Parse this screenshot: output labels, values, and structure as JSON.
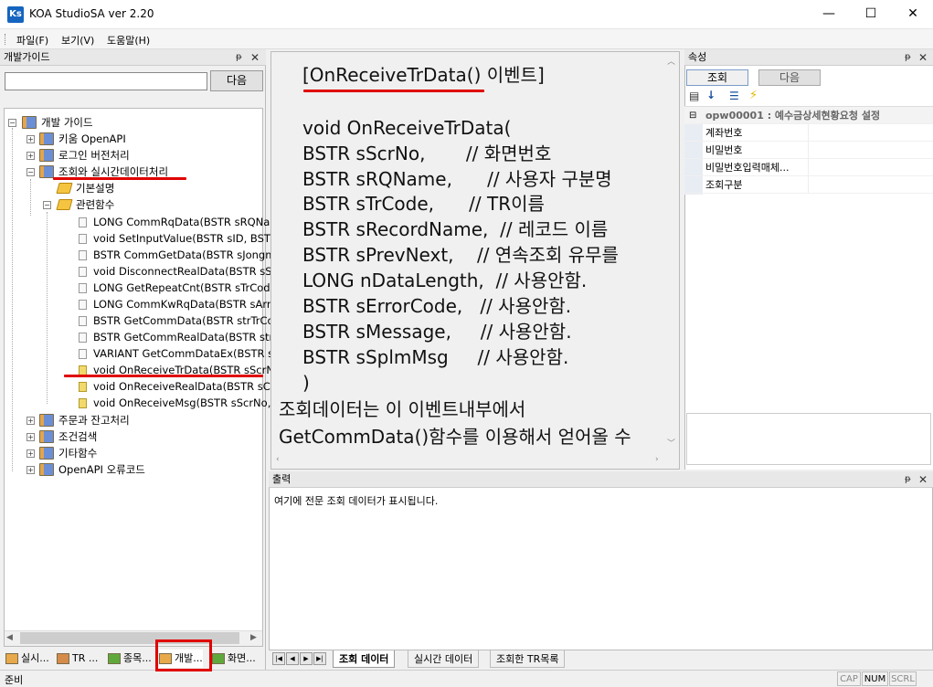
{
  "window": {
    "icon_text": "Ks",
    "title": "KOA StudioSA ver 2.20",
    "minimize": "—",
    "maximize": "☐",
    "close": "✕"
  },
  "menu": [
    {
      "label": "파일(F)"
    },
    {
      "label": "보기(V)"
    },
    {
      "label": "도움말(H)"
    }
  ],
  "left_panel": {
    "title": "개발가이드",
    "pin": "ᵽ",
    "close": "✕",
    "search_value": "",
    "next_button": "다음",
    "tree": {
      "root": "개발 가이드",
      "items": [
        {
          "label": "키움 OpenAPI"
        },
        {
          "label": "로그인 버전처리"
        },
        {
          "label": "조회와 실시간데이터처리"
        },
        {
          "label": "기본설명"
        },
        {
          "label": "관련함수"
        },
        {
          "label": "LONG CommRqData(BSTR sRQNa"
        },
        {
          "label": "void SetInputValue(BSTR sID, BSTF"
        },
        {
          "label": "BSTR CommGetData(BSTR sJongm"
        },
        {
          "label": "void DisconnectRealData(BSTR sSc"
        },
        {
          "label": "LONG GetRepeatCnt(BSTR sTrCode"
        },
        {
          "label": "LONG CommKwRqData(BSTR sArr"
        },
        {
          "label": "BSTR GetCommData(BSTR strTrCo"
        },
        {
          "label": "BSTR GetCommRealData(BSTR strC"
        },
        {
          "label": "VARIANT GetCommDataEx(BSTR s"
        },
        {
          "label": "void OnReceiveTrData(BSTR sScrN"
        },
        {
          "label": "void OnReceiveRealData(BSTR sCo"
        },
        {
          "label": "void OnReceiveMsg(BSTR sScrNo,"
        },
        {
          "label": "주문과 잔고처리"
        },
        {
          "label": "조건검색"
        },
        {
          "label": "기타함수"
        },
        {
          "label": "OpenAPI 오류코드"
        }
      ]
    },
    "bottom_tabs": [
      {
        "label": "실시..."
      },
      {
        "label": "TR ..."
      },
      {
        "label": "종목..."
      },
      {
        "label": "개발..."
      },
      {
        "label": "화면..."
      }
    ]
  },
  "doc": {
    "lines": [
      "[OnReceiveTrData() 이벤트]",
      "",
      "void OnReceiveTrData(",
      "BSTR sScrNo,       // 화면번호",
      "BSTR sRQName,      // 사용자 구분명",
      "BSTR sTrCode,      // TR이름",
      "BSTR sRecordName,  // 레코드 이름",
      "BSTR sPrevNext,    // 연속조회 유무를",
      "LONG nDataLength,  // 사용안함.",
      "BSTR sErrorCode,   // 사용안함.",
      "BSTR sMessage,     // 사용안함.",
      "BSTR sSplmMsg     // 사용안함.",
      ")",
      "조회데이터는 이 이벤트내부에서",
      "GetCommData()함수를 이용해서 얻어올 수"
    ]
  },
  "properties": {
    "title": "속성",
    "tab1": "조회",
    "tab2": "다음",
    "group": "opw00001 : 예수금상세현황요청 설정",
    "rows": [
      {
        "label": "계좌번호",
        "value": ""
      },
      {
        "label": "비밀번호",
        "value": ""
      },
      {
        "label": "비밀번호입력매체...",
        "value": ""
      },
      {
        "label": "조회구분",
        "value": ""
      }
    ]
  },
  "output": {
    "title": "출력",
    "text": "여기에 전문 조회 데이터가 표시됩니다.",
    "tabs": [
      {
        "label": "조회 데이터"
      },
      {
        "label": "실시간 데이터"
      },
      {
        "label": "조회한 TR목록"
      }
    ]
  },
  "status": {
    "text": "준비",
    "cap": "CAP",
    "num": "NUM",
    "scrl": "SCRL"
  },
  "colors": {
    "annotation_red": "#e00000",
    "accent_blue": "#1565c0"
  }
}
